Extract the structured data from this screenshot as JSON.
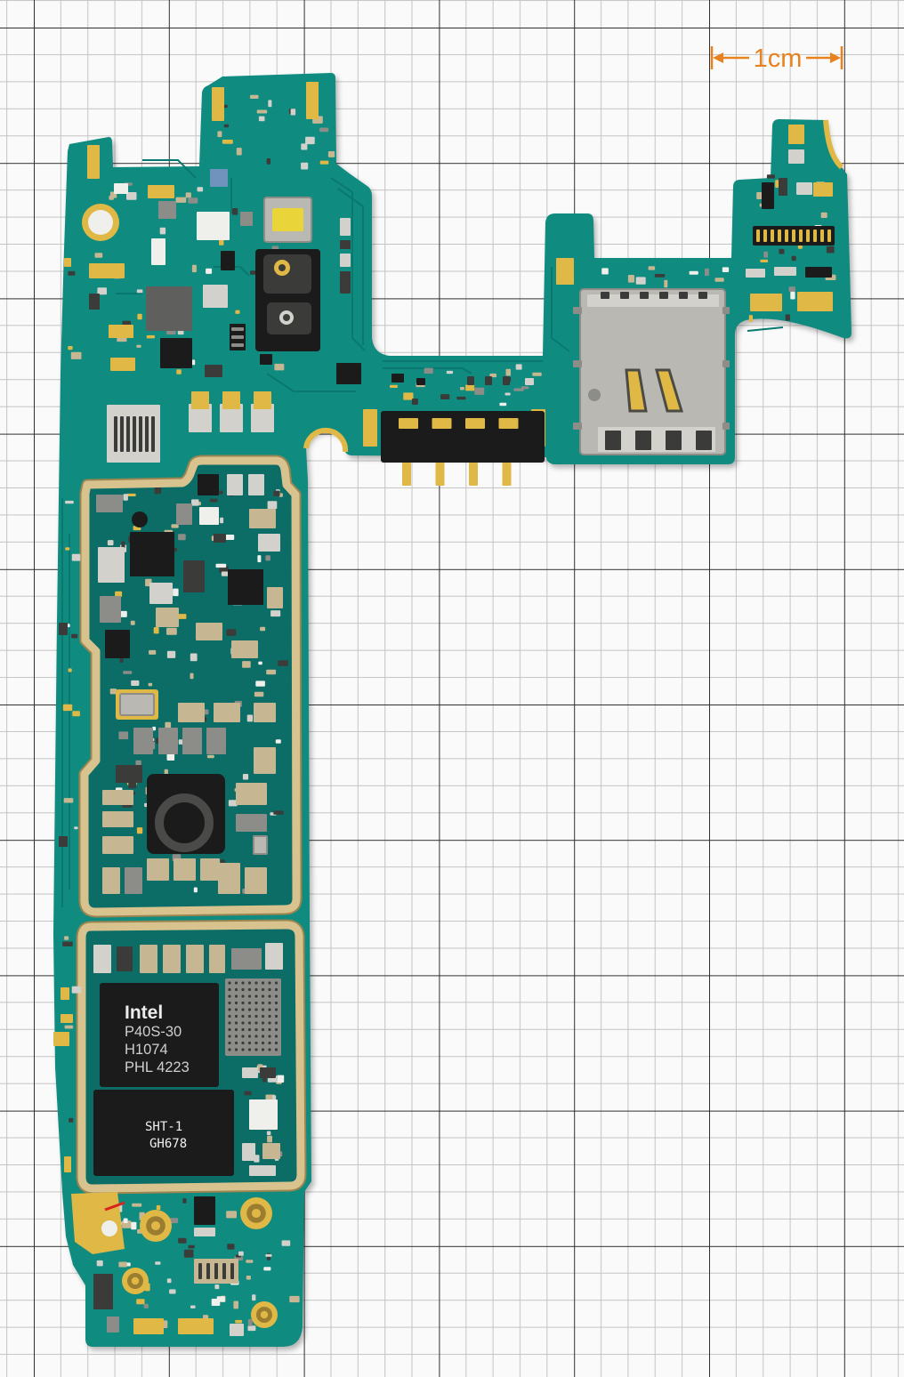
{
  "scale_bar": {
    "label": "1cm"
  },
  "chips": {
    "baseband": {
      "brand": "Intel",
      "lines": [
        "P40S-30",
        "H1074",
        "PHL 4223"
      ]
    },
    "memory": {
      "lines": [
        "SHT-1",
        "GH678"
      ]
    }
  },
  "colors": {
    "paper": "#fafafa",
    "grid_major": "#2f2f2f",
    "grid_minor": "#c4c4c4",
    "pcb": "#0f8b80",
    "pcb_shielded": "#0b6d66",
    "shield": "#d8c38f",
    "gold_pad": "#e0b845",
    "chip": "#1b1b1b",
    "sim_tray": "#b9b8b2",
    "scale_annotation": "#e8821e"
  }
}
